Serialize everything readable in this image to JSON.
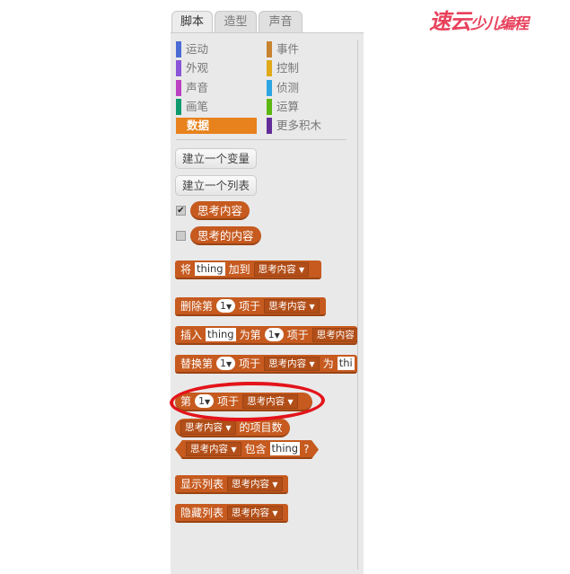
{
  "watermark": "速云少儿编程",
  "tabs": [
    {
      "label": "脚本",
      "active": true
    },
    {
      "label": "造型"
    },
    {
      "label": "声音"
    }
  ],
  "categories": [
    {
      "label": "运动",
      "color": "#4a6cd4"
    },
    {
      "label": "事件",
      "color": "#c88330"
    },
    {
      "label": "外观",
      "color": "#8a55d7"
    },
    {
      "label": "控制",
      "color": "#e1a91a"
    },
    {
      "label": "声音",
      "color": "#bb42c3"
    },
    {
      "label": "侦测",
      "color": "#2ca5e2"
    },
    {
      "label": "画笔",
      "color": "#0e9a6c"
    },
    {
      "label": "运算",
      "color": "#5cb712"
    },
    {
      "label": "数据",
      "color": "#ee7d16",
      "selected": true
    },
    {
      "label": "更多积木",
      "color": "#632d99"
    }
  ],
  "buttons": {
    "make_variable": "建立一个变量",
    "make_list": "建立一个列表"
  },
  "lists": [
    {
      "name": "思考内容",
      "checked": true,
      "check": "✔"
    },
    {
      "name": "思考的内容",
      "checked": false
    }
  ],
  "blocks": {
    "add": {
      "a": "将",
      "value": "thing",
      "b": "加到",
      "list": "思考内容"
    },
    "delete": {
      "a": "删除第",
      "index": "1",
      "b": "项于",
      "list": "思考内容"
    },
    "insert": {
      "a": "插入",
      "value": "thing",
      "b": "为第",
      "index": "1",
      "c": "项于",
      "list": "思考内容"
    },
    "replace": {
      "a": "替换第",
      "index": "1",
      "b": "项于",
      "list": "思考内容",
      "c": "为",
      "value": "thi"
    },
    "item": {
      "a": "第",
      "index": "1",
      "b": "项于",
      "list": "思考内容"
    },
    "length": {
      "list": "思考内容",
      "a": "的项目数"
    },
    "contains": {
      "list": "思考内容",
      "a": "包含",
      "value": "thing",
      "q": "?"
    },
    "show": {
      "a": "显示列表",
      "list": "思考内容"
    },
    "hide": {
      "a": "隐藏列表",
      "list": "思考内容"
    }
  },
  "highlight_color": "#e3141b",
  "block_color": "#c65a1f"
}
